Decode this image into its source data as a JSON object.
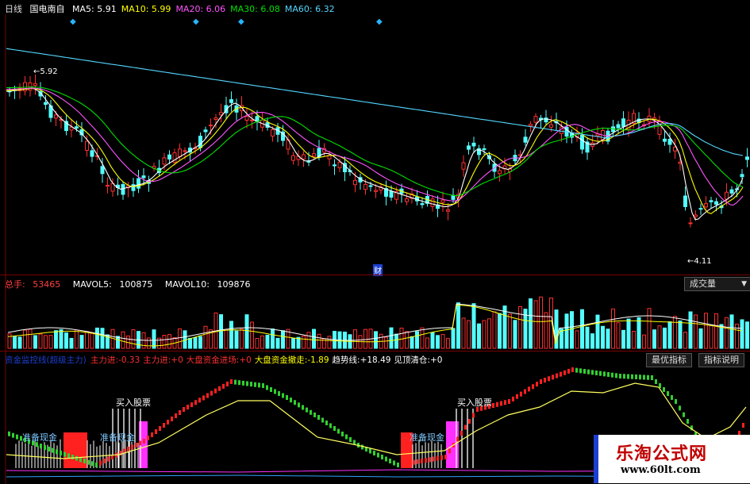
{
  "price": {
    "period": "日线",
    "stock_name": "国电南自",
    "ma": [
      {
        "label": "MA5:",
        "value": "5.91",
        "color": "#ffffff"
      },
      {
        "label": "MA10:",
        "value": "5.99",
        "color": "#ffff00"
      },
      {
        "label": "MA20:",
        "value": "6.06",
        "color": "#ff55ff"
      },
      {
        "label": "MA30:",
        "value": "6.08",
        "color": "#00e000"
      },
      {
        "label": "MA60:",
        "value": "6.32",
        "color": "#54d6ff"
      }
    ],
    "high_label": "5.92",
    "low_label": "4.11",
    "finance_mark": "财"
  },
  "volume": {
    "label": "总手:",
    "value": "53465",
    "mavol5_label": "MAVOL5:",
    "mavol5_value": "100875",
    "mavol10_label": "MAVOL10:",
    "mavol10_value": "109876",
    "selector": "成交量",
    "selector_arrow": "▼"
  },
  "indicator": {
    "title": "资金监控线(超级主力)",
    "items": [
      {
        "label": "主力进:",
        "value": "-0.33",
        "color": "#ff3030"
      },
      {
        "label": "主力进:",
        "value": "+0",
        "color": "#ff3030"
      },
      {
        "label": "大盘资金进场:",
        "value": "+0",
        "color": "#ff3030"
      },
      {
        "label": "大盘资金撤走:",
        "value": "-1.89",
        "color": "#ffff00"
      },
      {
        "label": "趋势线:",
        "value": "+18.49",
        "color": "#ffffff"
      },
      {
        "label": "见顶清仓:",
        "value": "+0",
        "color": "#ffffff"
      }
    ],
    "buttons": [
      "最优指标",
      "指标说明"
    ],
    "annotations": [
      "准备现金",
      "准备现金",
      "买入股票",
      "准备现金",
      "买入股票"
    ]
  },
  "watermark": {
    "title": "乐淘公式网",
    "url": "www.60lt.com"
  }
}
